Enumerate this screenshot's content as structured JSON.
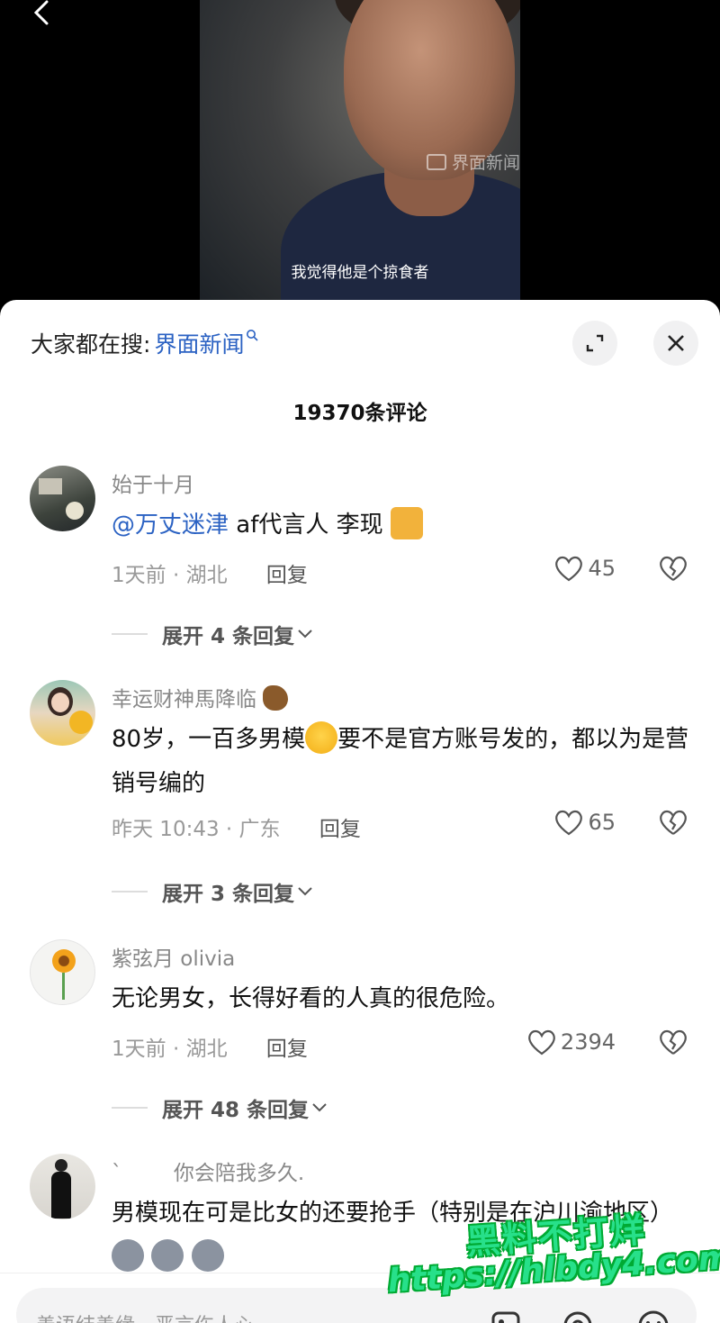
{
  "video": {
    "watermark": "界面新闻",
    "subtitle": "我觉得他是个掠食者"
  },
  "panel": {
    "search_prefix": "大家都在搜:",
    "search_keyword": "界面新闻",
    "comment_count": "19370条评论"
  },
  "comments": [
    {
      "username": "始于十月",
      "mention": "@万丈迷津",
      "text": " af代言人 李现",
      "emoji": "cat-emoji",
      "time_location": "1天前 · 湖北",
      "reply_label": "回复",
      "likes": "45",
      "expand_label": "展开 4 条回复"
    },
    {
      "username": "幸运财神馬降临",
      "username_emoji": "horse-emoji",
      "text_before": "80岁，一百多男模",
      "text_after": "要不是官方账号发的，都以为是营销号编的",
      "time_location": "昨天 10:43 · 广东",
      "reply_label": "回复",
      "likes": "65",
      "expand_label": "展开 3 条回复"
    },
    {
      "username": "紫弦月 olivia",
      "text": "无论男女，长得好看的人真的很危险。",
      "time_location": "1天前 · 湖北",
      "reply_label": "回复",
      "likes": "2394",
      "expand_label": "展开 48 条回复"
    },
    {
      "username_prefix": "`",
      "username": "你会陪我多久.",
      "text": "男模现在可是比女的还要抢手（特别是在沪川渝地区）",
      "emoji": "wolf-emoji"
    }
  ],
  "input": {
    "placeholder": "善语结善缘，恶言伤人心"
  },
  "overlay": {
    "line1": "黑料不打烊",
    "line2": "https://hlbdy4.com"
  },
  "colors": {
    "accent": "#2b62c3",
    "watermark": "#27e08a"
  }
}
